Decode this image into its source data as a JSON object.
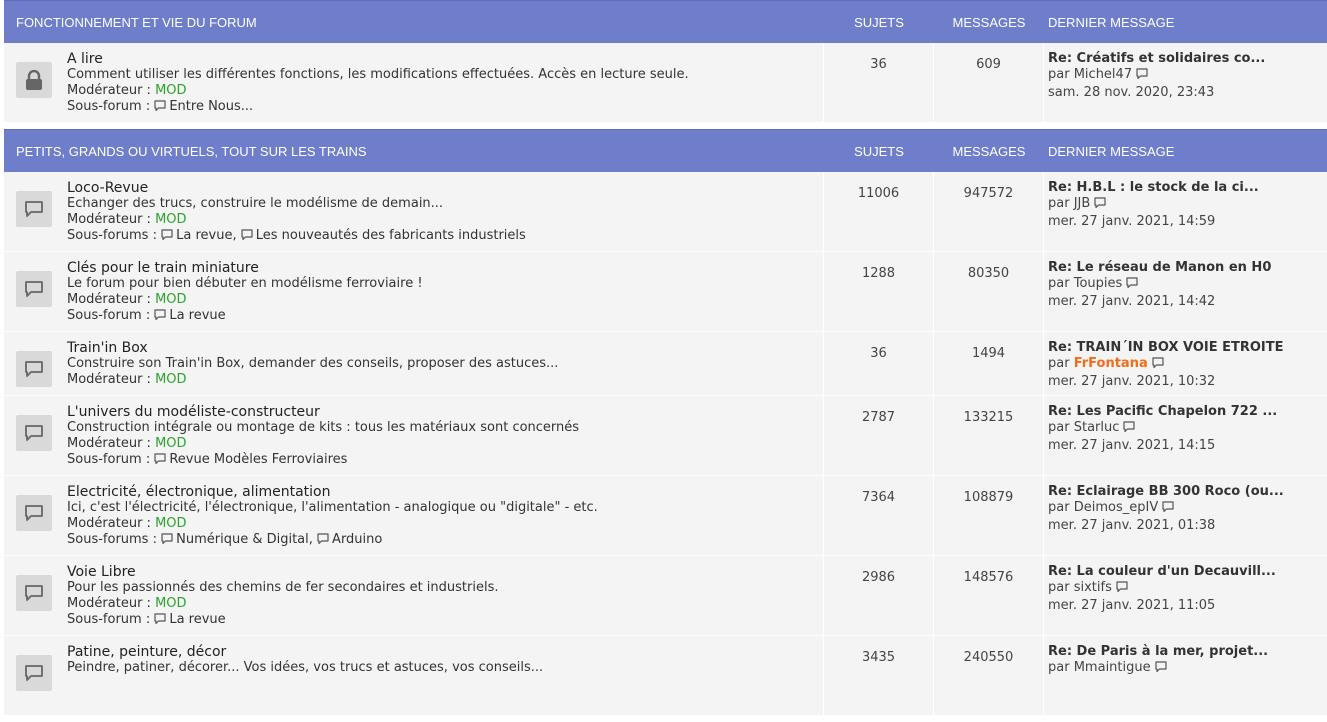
{
  "categories": [
    {
      "title": "FONCTIONNEMENT ET VIE DU FORUM",
      "col_topics": "SUJETS",
      "col_posts": "MESSAGES",
      "col_last": "DERNIER MESSAGE",
      "forums": [
        {
          "icon": "lock-icon",
          "title": "A lire",
          "description": "Comment utiliser les différentes fonctions, les modifications effectuées. Accès en lecture seule.",
          "moderator_label": "Modérateur :",
          "moderator": "MOD",
          "subforums_label": "Sous-forum :",
          "subforums": [
            "Entre Nous..."
          ],
          "topics": "36",
          "posts": "609",
          "last": {
            "title": "Re: Créatifs et solidaires co...",
            "by": "par",
            "author": "Michel47",
            "date": "sam. 28 nov. 2020, 23:43"
          }
        }
      ]
    },
    {
      "title": "PETITS, GRANDS OU VIRTUELS, TOUT SUR LES TRAINS",
      "col_topics": "SUJETS",
      "col_posts": "MESSAGES",
      "col_last": "DERNIER MESSAGE",
      "forums": [
        {
          "icon": "speech-bubble-icon",
          "title": "Loco-Revue",
          "description": "Echanger des trucs, construire le modélisme de demain...",
          "moderator_label": "Modérateur :",
          "moderator": "MOD",
          "subforums_label": "Sous-forums :",
          "subforums": [
            "La revue,",
            "Les nouveautés des fabricants industriels"
          ],
          "topics": "11006",
          "posts": "947572",
          "last": {
            "title": "Re: H.B.L : le stock de la ci...",
            "by": "par",
            "author": "JJB",
            "date": "mer. 27 janv. 2021, 14:59"
          }
        },
        {
          "icon": "speech-bubble-icon",
          "title": "Clés pour le train miniature",
          "description": "Le forum pour bien débuter en modélisme ferroviaire !",
          "moderator_label": "Modérateur :",
          "moderator": "MOD",
          "subforums_label": "Sous-forum :",
          "subforums": [
            "La revue"
          ],
          "topics": "1288",
          "posts": "80350",
          "last": {
            "title": "Re: Le réseau de Manon en H0",
            "by": "par",
            "author": "Toupies",
            "date": "mer. 27 janv. 2021, 14:42"
          }
        },
        {
          "icon": "speech-bubble-icon",
          "title": "Train'in Box",
          "description": "Construire son Train'in Box, demander des conseils, proposer des astuces...",
          "moderator_label": "Modérateur :",
          "moderator": "MOD",
          "subforums_label": "",
          "subforums": [],
          "topics": "36",
          "posts": "1494",
          "last": {
            "title": "Re: TRAIN´IN BOX VOIE ETROITE",
            "by": "par",
            "author": "FrFontana",
            "author_highlight": true,
            "date": "mer. 27 janv. 2021, 10:32"
          }
        },
        {
          "icon": "speech-bubble-icon",
          "title": "L'univers du modéliste-constructeur",
          "description": "Construction intégrale ou montage de kits : tous les matériaux sont concernés",
          "moderator_label": "Modérateur :",
          "moderator": "MOD",
          "subforums_label": "Sous-forum :",
          "subforums": [
            "Revue Modèles Ferroviaires"
          ],
          "topics": "2787",
          "posts": "133215",
          "last": {
            "title": "Re: Les Pacific Chapelon 722 ...",
            "by": "par",
            "author": "Starluc",
            "date": "mer. 27 janv. 2021, 14:15"
          }
        },
        {
          "icon": "speech-bubble-icon",
          "title": "Electricité, électronique, alimentation",
          "description": "Ici, c'est l'électricité, l'électronique, l'alimentation - analogique ou \"digitale\" - etc.",
          "moderator_label": "Modérateur :",
          "moderator": "MOD",
          "subforums_label": "Sous-forums :",
          "subforums": [
            "Numérique & Digital,",
            "Arduino"
          ],
          "topics": "7364",
          "posts": "108879",
          "last": {
            "title": "Re: Eclairage BB 300 Roco (ou...",
            "by": "par",
            "author": "Deimos_epIV",
            "date": "mer. 27 janv. 2021, 01:38"
          }
        },
        {
          "icon": "speech-bubble-icon",
          "title": "Voie Libre",
          "description": "Pour les passionnés des chemins de fer secondaires et industriels.",
          "moderator_label": "Modérateur :",
          "moderator": "MOD",
          "subforums_label": "Sous-forum :",
          "subforums": [
            "La revue"
          ],
          "topics": "2986",
          "posts": "148576",
          "last": {
            "title": "Re: La couleur d'un Decauvill...",
            "by": "par",
            "author": "sixtifs",
            "date": "mer. 27 janv. 2021, 11:05"
          }
        },
        {
          "icon": "speech-bubble-icon",
          "title": "Patine, peinture, décor",
          "description": "Peindre, patiner, décorer... Vos idées, vos trucs et astuces, vos conseils...",
          "moderator_label": "",
          "moderator": "",
          "subforums_label": "",
          "subforums": [],
          "topics": "3435",
          "posts": "240550",
          "last": {
            "title": "Re: De Paris à la mer, projet...",
            "by": "par",
            "author": "Mmaintigue",
            "date": ""
          }
        }
      ]
    }
  ]
}
